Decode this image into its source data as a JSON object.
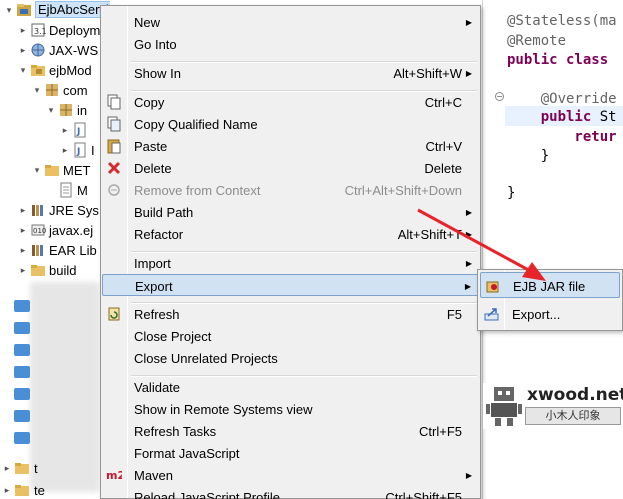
{
  "tree": {
    "items": [
      {
        "label": "EjbAbcService",
        "icon": "ejb-project-icon",
        "arrow": "▾",
        "indent": 0
      },
      {
        "label": "Deploym",
        "icon": "deployment-descriptor-icon",
        "arrow": "▸",
        "indent": 1
      },
      {
        "label": "JAX-WS",
        "icon": "web-service-icon",
        "arrow": "▸",
        "indent": 1
      },
      {
        "label": "ejbMod",
        "icon": "package-folder-icon",
        "arrow": "▾",
        "indent": 1
      },
      {
        "label": "com",
        "icon": "package-icon",
        "arrow": "▾",
        "indent": 2
      },
      {
        "label": "in",
        "icon": "package-icon",
        "arrow": "▾",
        "indent": 3
      },
      {
        "label": "",
        "icon": "java-file-icon",
        "arrow": "▸",
        "indent": 4
      },
      {
        "label": "I",
        "icon": "java-file-icon",
        "arrow": "▸",
        "indent": 4
      },
      {
        "label": "MET",
        "icon": "folder-icon",
        "arrow": "▾",
        "indent": 2
      },
      {
        "label": "M",
        "icon": "manifest-file-icon",
        "arrow": "",
        "indent": 3
      },
      {
        "label": "JRE Sys",
        "icon": "library-icon",
        "arrow": "▸",
        "indent": 1
      },
      {
        "label": "javax.ej",
        "icon": "jar-icon",
        "arrow": "▸",
        "indent": 1
      },
      {
        "label": "EAR Lib",
        "icon": "library-icon",
        "arrow": "▸",
        "indent": 1
      },
      {
        "label": "build",
        "icon": "folder-icon",
        "arrow": "▸",
        "indent": 1
      }
    ],
    "bottom_items": [
      {
        "label": "t",
        "icon": "folder-icon"
      },
      {
        "label": "te",
        "icon": "folder-icon"
      }
    ]
  },
  "editor": {
    "lines": [
      {
        "parts": [
          {
            "cls": "ann",
            "text": "@Stateless(ma"
          }
        ]
      },
      {
        "parts": [
          {
            "cls": "ann",
            "text": "@Remote"
          }
        ]
      },
      {
        "parts": [
          {
            "cls": "kw",
            "text": "public class "
          }
        ]
      },
      {
        "parts": [
          {
            "cls": "plain",
            "text": ""
          }
        ]
      },
      {
        "parts": [
          {
            "cls": "ann",
            "text": "    @Override"
          }
        ]
      },
      {
        "parts": [
          {
            "cls": "kw",
            "text": "    public "
          },
          {
            "cls": "plain",
            "text": "St"
          }
        ]
      },
      {
        "parts": [
          {
            "cls": "kw",
            "text": "        retur"
          }
        ]
      },
      {
        "parts": [
          {
            "cls": "plain",
            "text": "    }"
          }
        ]
      },
      {
        "parts": [
          {
            "cls": "plain",
            "text": ""
          }
        ]
      },
      {
        "parts": [
          {
            "cls": "plain",
            "text": "}"
          }
        ]
      }
    ]
  },
  "menu": {
    "items": [
      {
        "label": "New",
        "shortcut": "",
        "submenu": true,
        "icon": "",
        "disabled": false
      },
      {
        "label": "Go Into",
        "shortcut": "",
        "submenu": false,
        "icon": "",
        "disabled": false
      },
      {
        "sep": true
      },
      {
        "label": "Show In",
        "shortcut": "Alt+Shift+W",
        "submenu": true,
        "icon": "",
        "disabled": false
      },
      {
        "sep": true
      },
      {
        "label": "Copy",
        "shortcut": "Ctrl+C",
        "submenu": false,
        "icon": "copy-icon",
        "disabled": false
      },
      {
        "label": "Copy Qualified Name",
        "shortcut": "",
        "submenu": false,
        "icon": "copy-qualified-icon",
        "disabled": false
      },
      {
        "label": "Paste",
        "shortcut": "Ctrl+V",
        "submenu": false,
        "icon": "paste-icon",
        "disabled": false
      },
      {
        "label": "Delete",
        "shortcut": "Delete",
        "submenu": false,
        "icon": "delete-icon",
        "disabled": false
      },
      {
        "label": "Remove from Context",
        "shortcut": "Ctrl+Alt+Shift+Down",
        "submenu": false,
        "icon": "remove-context-icon",
        "disabled": true
      },
      {
        "label": "Build Path",
        "shortcut": "",
        "submenu": true,
        "icon": "",
        "disabled": false
      },
      {
        "label": "Refactor",
        "shortcut": "Alt+Shift+T",
        "submenu": true,
        "icon": "",
        "disabled": false
      },
      {
        "sep": true
      },
      {
        "label": "Import",
        "shortcut": "",
        "submenu": true,
        "icon": "",
        "disabled": false
      },
      {
        "label": "Export",
        "shortcut": "",
        "submenu": true,
        "icon": "",
        "disabled": false,
        "active": true
      },
      {
        "sep": true
      },
      {
        "label": "Refresh",
        "shortcut": "F5",
        "submenu": false,
        "icon": "refresh-icon",
        "disabled": false
      },
      {
        "label": "Close Project",
        "shortcut": "",
        "submenu": false,
        "icon": "",
        "disabled": false
      },
      {
        "label": "Close Unrelated Projects",
        "shortcut": "",
        "submenu": false,
        "icon": "",
        "disabled": false
      },
      {
        "sep": true
      },
      {
        "label": "Validate",
        "shortcut": "",
        "submenu": false,
        "icon": "",
        "disabled": false
      },
      {
        "label": "Show in Remote Systems view",
        "shortcut": "",
        "submenu": false,
        "icon": "",
        "disabled": false
      },
      {
        "label": "Refresh Tasks",
        "shortcut": "Ctrl+F5",
        "submenu": false,
        "icon": "",
        "disabled": false
      },
      {
        "label": "Format JavaScript",
        "shortcut": "",
        "submenu": false,
        "icon": "",
        "disabled": false
      },
      {
        "label": "Maven",
        "shortcut": "",
        "submenu": true,
        "icon": "maven-icon",
        "disabled": false
      },
      {
        "label": "Reload JavaScript Profile",
        "shortcut": "Ctrl+Shift+F5",
        "submenu": false,
        "icon": "",
        "disabled": false
      }
    ]
  },
  "submenu": {
    "items": [
      {
        "label": "EJB JAR file",
        "icon": "ejb-jar-export-icon",
        "active": true
      },
      {
        "label": "Export...",
        "icon": "export-wizard-icon",
        "active": false
      }
    ]
  },
  "watermark": {
    "brand": "xwood.net",
    "subtitle": "小木人印象"
  },
  "colors": {
    "menu_bg": "#f0f0f0",
    "menu_active": "#d1e2f2",
    "annotation_arrow": "#e8232a",
    "keyword": "#7f0055",
    "annotation": "#646464"
  }
}
